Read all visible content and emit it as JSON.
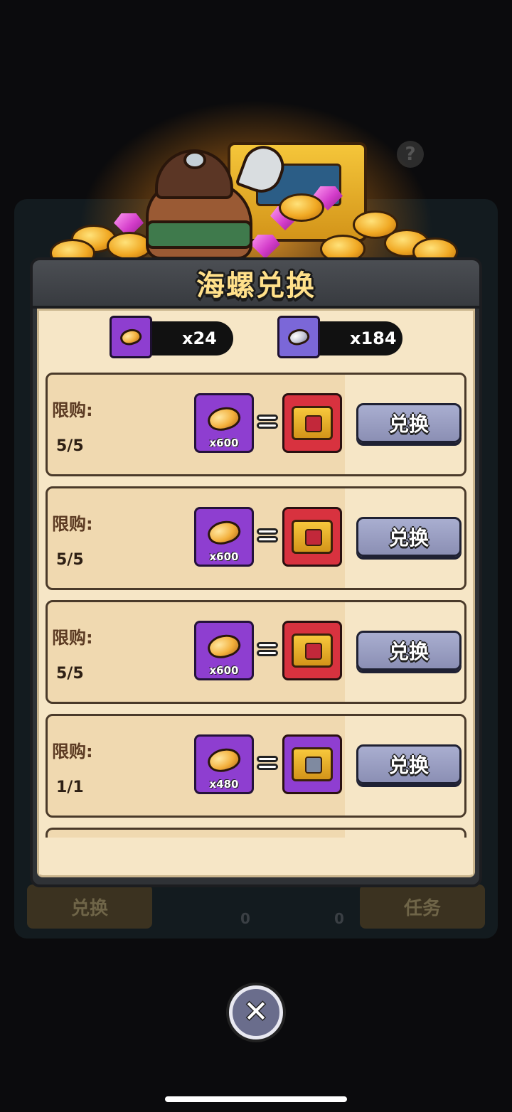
{
  "dialog": {
    "title": "海螺兑换"
  },
  "currencies": [
    {
      "icon": "golden-conch-icon",
      "amount": "x24"
    },
    {
      "icon": "silver-conch-icon",
      "amount": "x184"
    }
  ],
  "exchange_items": [
    {
      "limit_label": "限购:",
      "limit_count": "5/5",
      "cost_icon": "golden-conch-icon",
      "cost_qty": "x600",
      "reward_icon": "red-chest-icon",
      "button_label": "兑换"
    },
    {
      "limit_label": "限购:",
      "limit_count": "5/5",
      "cost_icon": "golden-conch-icon",
      "cost_qty": "x600",
      "reward_icon": "red-chest-icon",
      "button_label": "兑换"
    },
    {
      "limit_label": "限购:",
      "limit_count": "5/5",
      "cost_icon": "golden-conch-icon",
      "cost_qty": "x600",
      "reward_icon": "red-chest-icon",
      "button_label": "兑换"
    },
    {
      "limit_label": "限购:",
      "limit_count": "1/1",
      "cost_icon": "golden-conch-icon",
      "cost_qty": "x480",
      "reward_icon": "purple-chest-icon",
      "button_label": "兑换"
    }
  ],
  "background": {
    "left_tab": "兑换",
    "right_tab": "任务",
    "counter_1": "0",
    "counter_2": "0"
  },
  "colors": {
    "cost_tile": "#8e3ed0",
    "reward_red": "#d8323f",
    "reward_purple": "#8f3ed1",
    "button": "#9a9ec4",
    "title_text": "#ffe08a"
  }
}
